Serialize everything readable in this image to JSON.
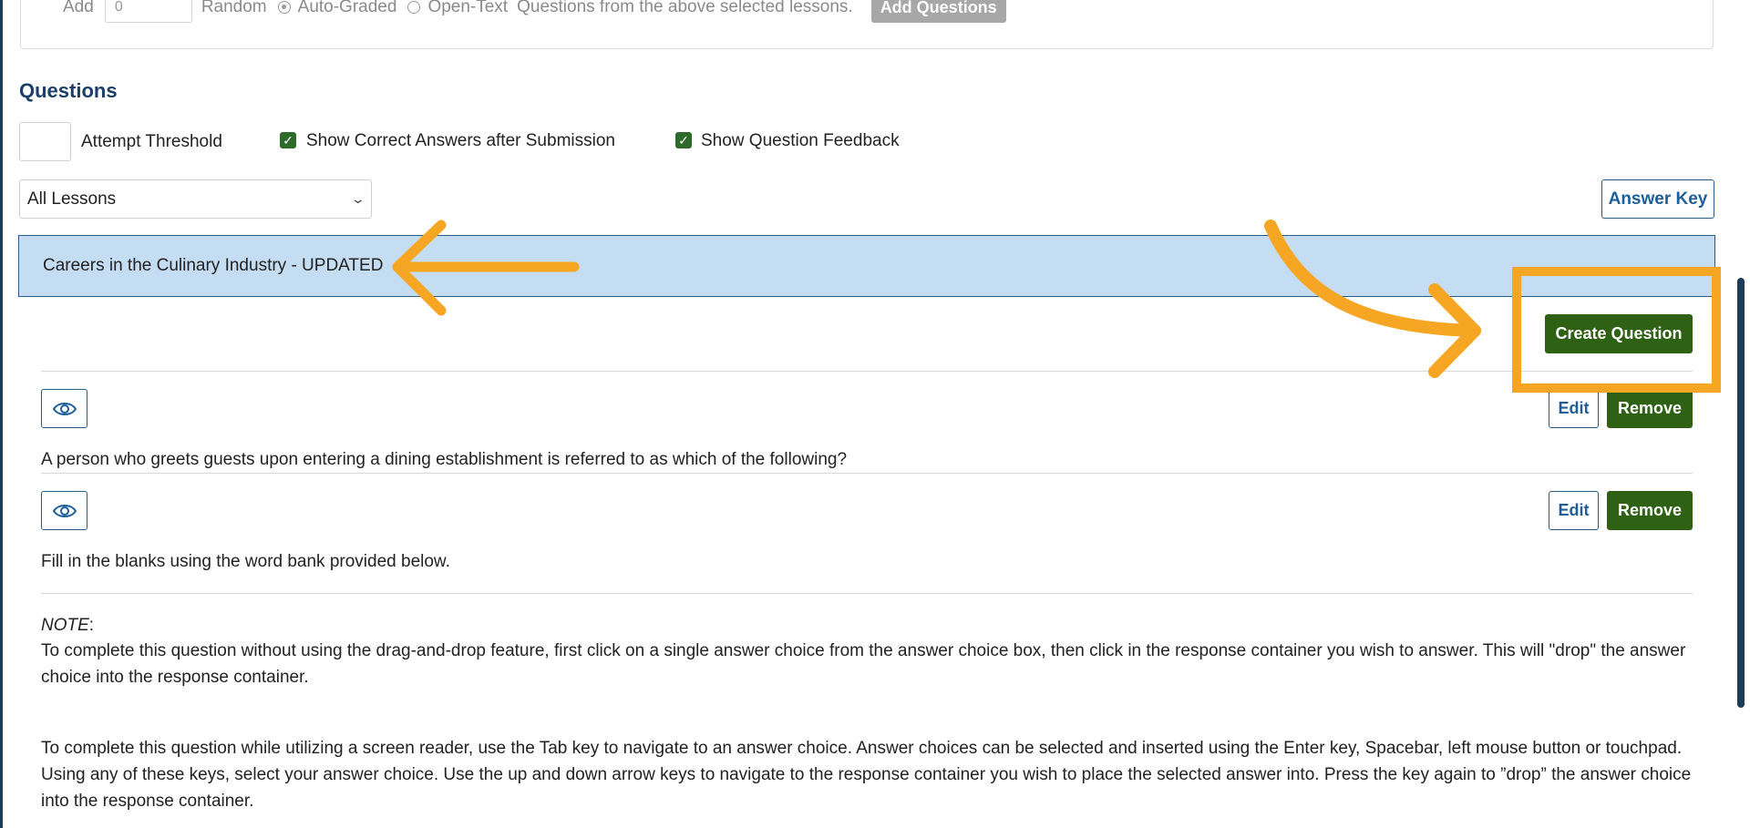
{
  "add_row": {
    "add_label": "Add",
    "count_value": "0",
    "random_label": "Random",
    "auto_graded_label": "Auto-Graded",
    "open_text_label": "Open-Text",
    "from_text": "Questions from the above selected lessons.",
    "add_button": "Add Questions"
  },
  "questions_section": {
    "title": "Questions",
    "attempt_threshold_label": "Attempt Threshold",
    "show_correct_answers_label": "Show Correct Answers after Submission",
    "show_feedback_label": "Show Question Feedback",
    "lesson_filter_value": "All Lessons",
    "answer_key_button": "Answer Key"
  },
  "lesson": {
    "title": "Careers in the Culinary Industry - UPDATED",
    "create_button": "Create Question"
  },
  "questions": [
    {
      "text": "A person who greets guests upon entering a dining establishment is referred to as which of the following?",
      "edit_label": "Edit",
      "remove_label": "Remove"
    },
    {
      "text": "Fill in the blanks using the word bank provided below.",
      "edit_label": "Edit",
      "remove_label": "Remove",
      "note_label": "NOTE",
      "note_colon": ":",
      "note_paragraph_1": "To complete this question without using the drag-and-drop feature, first click on a single answer choice from the answer choice box, then click in the response container you wish to answer. This will \"drop\" the answer choice into the response container.",
      "note_paragraph_2": "To complete this question while utilizing a screen reader, use the Tab key to navigate to an answer choice. Answer choices can be selected and inserted using the Enter key, Spacebar, left mouse button or touchpad. Using any of these keys, select your answer choice. Use the up and down arrow keys to navigate to the response container you wish to place the selected answer into. Press the key again to ”drop” the answer choice into the response container."
    }
  ],
  "colors": {
    "primary_green": "#2e6114",
    "link_blue": "#1e5f9a",
    "heading_navy": "#1b3f68",
    "lesson_bar_bg": "#c5ddf3",
    "annotation_orange": "#f6a623"
  },
  "icons": [
    "eye-icon",
    "chevron-down-icon",
    "chevron-up-icon",
    "checkmark-icon",
    "radio-icon"
  ]
}
